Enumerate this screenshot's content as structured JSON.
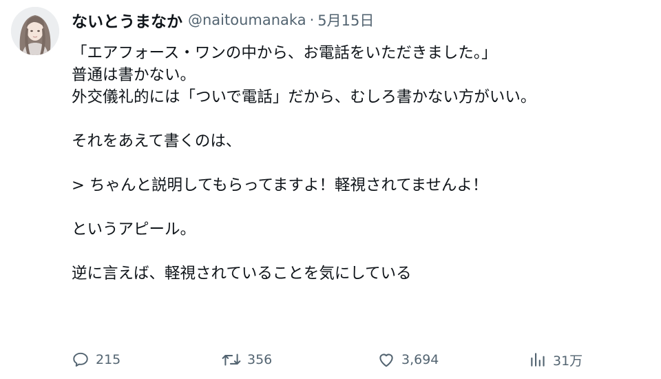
{
  "tweet": {
    "author": {
      "display_name": "ないとうまなか",
      "handle": "@naitoumanaka",
      "avatar_icon": "avatar-illustration"
    },
    "separator": "·",
    "date": "5月15日",
    "lines": [
      "「エアフォース・ワンの中から、お電話をいただきました。」",
      "普通は書かない。",
      "外交儀礼的には「ついで電話」だから、むしろ書かない方がいい。",
      "",
      "それをあえて書くのは、",
      "",
      "> ちゃんと説明してもらってますよ！軽視されてませんよ！",
      "",
      "というアピール。",
      "",
      "逆に言えば、軽視されていることを気にしている"
    ],
    "actions": {
      "reply": {
        "icon": "reply-icon",
        "count": "215"
      },
      "retweet": {
        "icon": "retweet-icon",
        "count": "356"
      },
      "like": {
        "icon": "heart-icon",
        "count": "3,694"
      },
      "views": {
        "icon": "views-icon",
        "count": "31万"
      }
    },
    "colors": {
      "text": "#0f1419",
      "secondary": "#536471",
      "background": "#ffffff"
    }
  }
}
